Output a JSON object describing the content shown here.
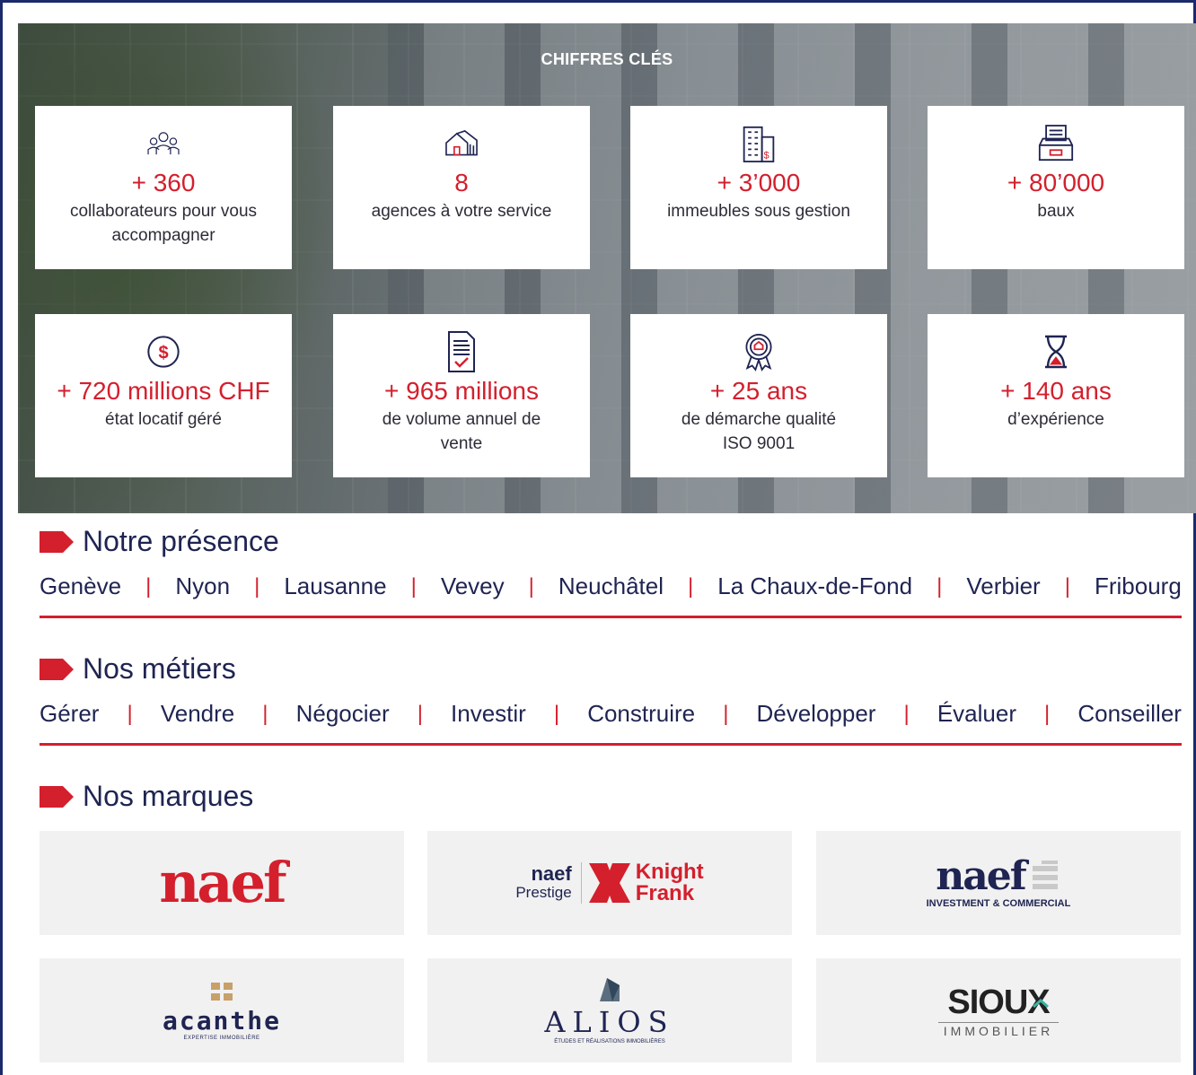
{
  "hero": {
    "title": "CHIFFRES CLÉS"
  },
  "stats": [
    {
      "icon": "team-icon",
      "value": "+ 360",
      "label": "collaborateurs pour vous accompagner"
    },
    {
      "icon": "houses-icon",
      "value": "8",
      "label": "agences à votre service"
    },
    {
      "icon": "building-icon",
      "value": "+ 3’000",
      "label": "immeubles sous gestion"
    },
    {
      "icon": "file-tray-icon",
      "value": "+ 80’000",
      "label": "baux"
    },
    {
      "icon": "dollar-coin-icon",
      "value": "+ 720 millions CHF",
      "label": "état locatif géré"
    },
    {
      "icon": "document-check-icon",
      "value": "+ 965 millions",
      "label": "de volume annuel de vente"
    },
    {
      "icon": "award-ribbon-icon",
      "value": "+ 25 ans",
      "label": "de démarche qualité ISO 9001"
    },
    {
      "icon": "hourglass-icon",
      "value": "+ 140 ans",
      "label": "d’expérience"
    }
  ],
  "presence": {
    "title": "Notre présence",
    "items": [
      "Genève",
      "Nyon",
      "Lausanne",
      "Vevey",
      "Neuchâtel",
      "La Chaux-de-Fond",
      "Verbier",
      "Fribourg"
    ]
  },
  "metiers": {
    "title": "Nos métiers",
    "items": [
      "Gérer",
      "Vendre",
      "Négocier",
      "Investir",
      "Construire",
      "Développer",
      "Évaluer",
      "Conseiller"
    ]
  },
  "marques": {
    "title": "Nos marques",
    "brands": [
      {
        "name": "naef"
      },
      {
        "name": "naef Prestige Knight Frank",
        "line1": "naef",
        "line2": "Prestige",
        "partner1": "Knight",
        "partner2": "Frank"
      },
      {
        "name": "naef Investment & Commercial",
        "line1": "naef",
        "line2": "INVESTMENT & COMMERCIAL"
      },
      {
        "name": "acanthe",
        "line1": "acanthe",
        "line2": "EXPERTISE IMMOBILIÈRE"
      },
      {
        "name": "ALIOS",
        "line1": "ALIOS",
        "line2": "ÉTUDES ET RÉALISATIONS IMMOBILIÈRES"
      },
      {
        "name": "SIOUX Immobilier",
        "line1": "SIOUX",
        "line2": "IMMOBILIER"
      }
    ]
  },
  "colors": {
    "accent": "#d41f2d",
    "navy": "#1f2452",
    "brand_bg": "#f1f1f1"
  }
}
